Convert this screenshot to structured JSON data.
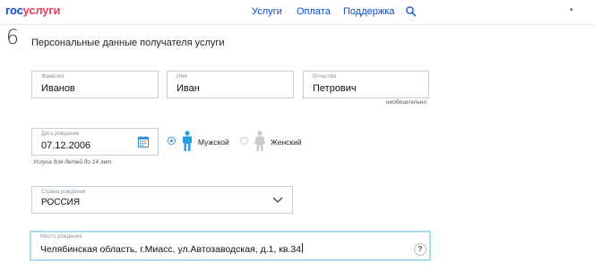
{
  "header": {
    "logo_part1": "гос",
    "logo_part2": "услуги",
    "nav": [
      "Услуги",
      "Оплата",
      "Поддержка"
    ],
    "search_icon": "search-icon",
    "menu_caret": "▾"
  },
  "step": {
    "number": "6",
    "title": "Персональные данные получателя услуги"
  },
  "fields": {
    "surname": {
      "label": "Фамилия",
      "value": "Иванов"
    },
    "name": {
      "label": "Имя",
      "value": "Иван"
    },
    "patronymic": {
      "label": "Отчество",
      "value": "Петрович",
      "hint": "необязательно"
    },
    "birth_date": {
      "label": "Дата рождения",
      "value": "07.12.2006",
      "hint": "Услуга для детей до 14 лет"
    },
    "gender": {
      "options": [
        {
          "label": "Мужской",
          "selected": true
        },
        {
          "label": "Женский",
          "selected": false
        }
      ]
    },
    "birth_country": {
      "label": "Страна рождения",
      "value": "РОССИЯ"
    },
    "birth_place": {
      "label": "Место рождения",
      "value": "Челябинская область, г.Миасс, ул.Автозаводская, д.1, кв.34",
      "help": "?"
    }
  },
  "colors": {
    "brand_blue": "#0d4cd3",
    "brand_red": "#ee3f58",
    "male_icon": "#2a9ee0",
    "female_icon": "#c8ccd0",
    "focus_border": "#a8dfef"
  }
}
